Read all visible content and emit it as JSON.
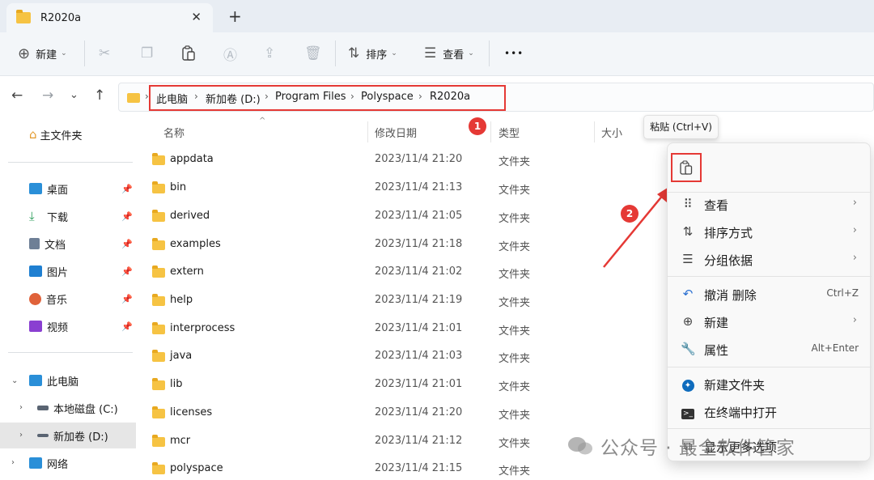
{
  "tab": {
    "title": "R2020a",
    "close": "✕",
    "add": "+"
  },
  "toolbar": {
    "new_label": "新建",
    "sort_label": "排序",
    "view_label": "查看",
    "more": "•••"
  },
  "breadcrumb": [
    "此电脑",
    "新加卷 (D:)",
    "Program Files",
    "Polyspace",
    "R2020a"
  ],
  "sidebar": {
    "home": "主文件夹",
    "quick": [
      {
        "label": "桌面",
        "icon": "desktop-icon",
        "color": "#2a8fd8"
      },
      {
        "label": "下载",
        "icon": "download-icon",
        "color": "#2b9c5a"
      },
      {
        "label": "文档",
        "icon": "document-icon",
        "color": "#6e7f96"
      },
      {
        "label": "图片",
        "icon": "pictures-icon",
        "color": "#1f7fd1"
      },
      {
        "label": "音乐",
        "icon": "music-icon",
        "color": "#e0623a"
      },
      {
        "label": "视频",
        "icon": "video-icon",
        "color": "#8a3fd1"
      }
    ],
    "this_pc": "此电脑",
    "drive_c": "本地磁盘 (C:)",
    "drive_d": "新加卷 (D:)",
    "network": "网络"
  },
  "columns": {
    "name": "名称",
    "date": "修改日期",
    "type": "类型",
    "size": "大小"
  },
  "files": [
    {
      "name": "appdata",
      "date": "2023/11/4 21:20",
      "type": "文件夹"
    },
    {
      "name": "bin",
      "date": "2023/11/4 21:13",
      "type": "文件夹"
    },
    {
      "name": "derived",
      "date": "2023/11/4 21:05",
      "type": "文件夹"
    },
    {
      "name": "examples",
      "date": "2023/11/4 21:18",
      "type": "文件夹"
    },
    {
      "name": "extern",
      "date": "2023/11/4 21:02",
      "type": "文件夹"
    },
    {
      "name": "help",
      "date": "2023/11/4 21:19",
      "type": "文件夹"
    },
    {
      "name": "interprocess",
      "date": "2023/11/4 21:01",
      "type": "文件夹"
    },
    {
      "name": "java",
      "date": "2023/11/4 21:03",
      "type": "文件夹"
    },
    {
      "name": "lib",
      "date": "2023/11/4 21:01",
      "type": "文件夹"
    },
    {
      "name": "licenses",
      "date": "2023/11/4 21:20",
      "type": "文件夹"
    },
    {
      "name": "mcr",
      "date": "2023/11/4 21:12",
      "type": "文件夹"
    },
    {
      "name": "polyspace",
      "date": "2023/11/4 21:15",
      "type": "文件夹"
    }
  ],
  "badges": {
    "one": "1",
    "two": "2"
  },
  "tooltip": "粘贴 (Ctrl+V)",
  "context_menu": {
    "view": "查看",
    "sort_by": "排序方式",
    "group_by": "分组依据",
    "undo_delete": "撤消 删除",
    "undo_shortcut": "Ctrl+Z",
    "new": "新建",
    "properties": "属性",
    "properties_shortcut": "Alt+Enter",
    "new_folder": "新建文件夹",
    "open_terminal": "在终端中打开",
    "more_options": "显示更多选项"
  },
  "watermark": "公众号 · 最全软件管家",
  "colors": {
    "highlight": "#e53935",
    "folder": "#f6c343",
    "accent": "#0078d4"
  }
}
